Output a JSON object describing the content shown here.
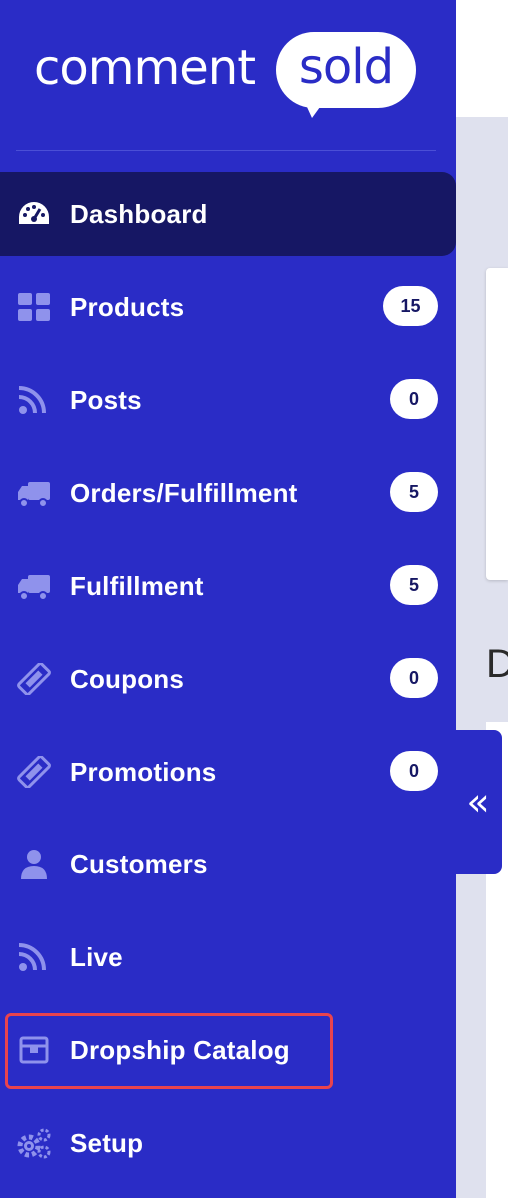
{
  "logo": {
    "word": "comment",
    "bubble": "sold"
  },
  "nav": [
    {
      "id": "dashboard",
      "label": "Dashboard",
      "icon": "tachometer-icon",
      "active": true
    },
    {
      "id": "products",
      "label": "Products",
      "icon": "grid-icon",
      "badge": "15"
    },
    {
      "id": "posts",
      "label": "Posts",
      "icon": "rss-icon",
      "badge": "0"
    },
    {
      "id": "orders",
      "label": "Orders/Fulfillment",
      "icon": "truck-icon",
      "badge": "5"
    },
    {
      "id": "fulfillment",
      "label": "Fulfillment",
      "icon": "truck-icon",
      "badge": "5"
    },
    {
      "id": "coupons",
      "label": "Coupons",
      "icon": "ticket-icon",
      "badge": "0"
    },
    {
      "id": "promotions",
      "label": "Promotions",
      "icon": "ticket-icon",
      "badge": "0"
    },
    {
      "id": "customers",
      "label": "Customers",
      "icon": "user-icon"
    },
    {
      "id": "live",
      "label": "Live",
      "icon": "rss-icon"
    },
    {
      "id": "dropship",
      "label": "Dropship Catalog",
      "icon": "box-icon",
      "highlighted": true
    },
    {
      "id": "setup",
      "label": "Setup",
      "icon": "gears-icon"
    }
  ],
  "content": {
    "heading_letter": "D"
  },
  "collapse": {
    "icon": "double-chevron-left-icon",
    "glyph": "«"
  },
  "colors": {
    "sidebar": "#2a2cc6",
    "active": "#161764",
    "icon": "#8f92ec",
    "badge_text": "#161764",
    "highlight": "#e9434d",
    "content_bg": "#dfe1ee"
  }
}
